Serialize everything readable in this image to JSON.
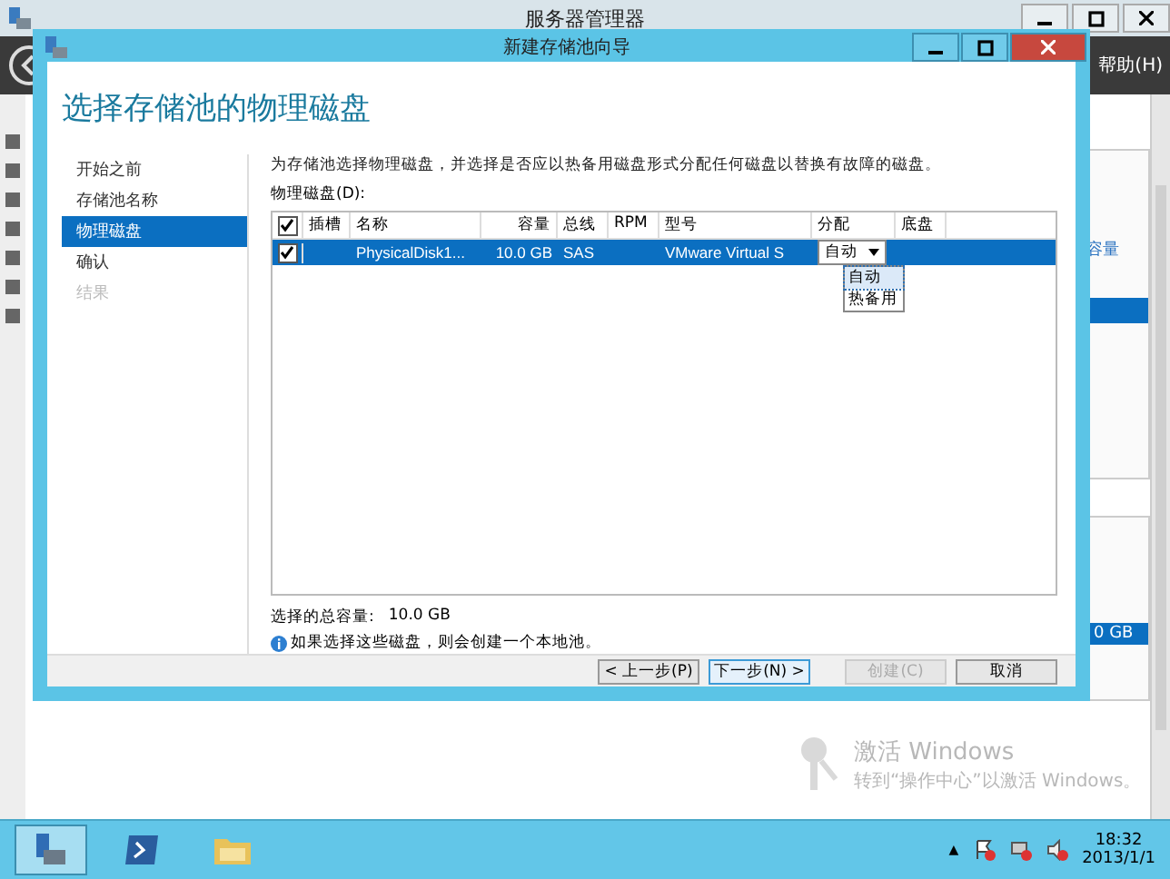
{
  "window": {
    "title": "服务器管理器",
    "menu": "帮助(H)",
    "right_header": "容量",
    "right_value": "0 GB"
  },
  "dialog": {
    "title": "新建存储池向导",
    "heading": "选择存储池的物理磁盘",
    "steps": [
      {
        "label": "开始之前",
        "selected": false,
        "disabled": false
      },
      {
        "label": "存储池名称",
        "selected": false,
        "disabled": false
      },
      {
        "label": "物理磁盘",
        "selected": true,
        "disabled": false
      },
      {
        "label": "确认",
        "selected": false,
        "disabled": false
      },
      {
        "label": "结果",
        "selected": false,
        "disabled": true
      }
    ],
    "description": "为存储池选择物理磁盘，并选择是否应以热备用磁盘形式分配任何磁盘以替换有故障的磁盘。",
    "table": {
      "label": "物理磁盘(D):",
      "all_checked": true,
      "columns": [
        {
          "label": "插槽",
          "kind": "text"
        },
        {
          "label": "名称",
          "kind": "text"
        },
        {
          "label": "容量",
          "kind": "number"
        },
        {
          "label": "总线",
          "kind": "text"
        },
        {
          "label": "RPM",
          "kind": "text"
        },
        {
          "label": "型号",
          "kind": "text"
        },
        {
          "label": "分配",
          "kind": "text"
        },
        {
          "label": "底盘",
          "kind": "text"
        }
      ],
      "rows": [
        {
          "checked": true,
          "selected": true,
          "cells": [
            {
              "kind": "blank"
            },
            {
              "kind": "text",
              "text": "PhysicalDisk1..."
            },
            {
              "kind": "number",
              "text": "10.0 GB"
            },
            {
              "kind": "text",
              "text": "SAS"
            },
            {
              "kind": "blank"
            },
            {
              "kind": "text",
              "text": "VMware Virtual S"
            },
            {
              "kind": "dropdown",
              "text": "自动"
            },
            {
              "kind": "blank"
            }
          ]
        }
      ]
    },
    "dropdown_options": [
      {
        "label": "自动",
        "selected": true
      },
      {
        "label": "热备用",
        "selected": false
      }
    ],
    "total_label": "选择的总容量:",
    "total_value": "10.0 GB",
    "info": "如果选择这些磁盘，则会创建一个本地池。",
    "buttons": [
      {
        "label": "< 上一步(P)",
        "disabled": false,
        "default": false
      },
      {
        "label": "下一步(N) >",
        "disabled": false,
        "default": true
      },
      {
        "label": "创建(C)",
        "disabled": true,
        "default": false
      },
      {
        "label": "取消",
        "disabled": false,
        "default": false
      }
    ]
  },
  "activation": {
    "title": "激活 Windows",
    "text": "转到“操作中心”以激活 Windows。"
  },
  "taskbar": {
    "tray_arrow": "▲",
    "time": "18:32",
    "date": "2013/1/1"
  }
}
